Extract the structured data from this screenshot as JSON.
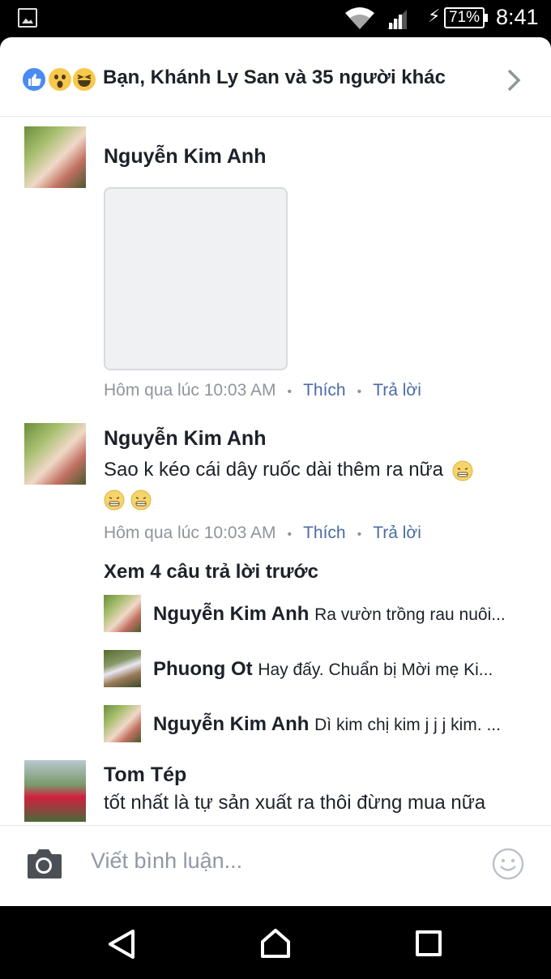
{
  "status_bar": {
    "battery": "71%",
    "time": "8:41"
  },
  "reactions": {
    "summary": "Bạn, Khánh Ly San và 35 người khác",
    "icons": [
      "like-icon",
      "wow-icon",
      "haha-icon"
    ]
  },
  "comments": [
    {
      "author": "Nguyễn Kim Anh",
      "attachment": "sticker",
      "timestamp": "Hôm qua lúc 10:03 AM",
      "like_label": "Thích",
      "reply_label": "Trả lời"
    },
    {
      "author": "Nguyễn Kim Anh",
      "text": "Sao k kéo cái dây ruốc dài thêm ra nữa",
      "timestamp": "Hôm qua lúc 10:03 AM",
      "like_label": "Thích",
      "reply_label": "Trả lời",
      "see_previous": "Xem 4 câu trả lời trước",
      "replies": [
        {
          "author": "Nguyễn Kim Anh",
          "text": "Ra vườn trồng rau nuôi..."
        },
        {
          "author": "Phuong Ot",
          "text": "Hay đấy. Chuẩn bị Mời mẹ Ki..."
        },
        {
          "author": "Nguyễn Kim Anh",
          "text": "Dì kim chị kim j j j kim. ..."
        }
      ]
    },
    {
      "author": "Tom Tép",
      "text": "tốt nhất là tự sản xuất ra thôi đừng mua nữa"
    }
  ],
  "composer": {
    "placeholder": "Viết bình luận..."
  },
  "colors": {
    "link": "#4b6aa7",
    "meta": "#90949c",
    "text": "#1d2129",
    "like_blue": "#4a8af4"
  }
}
